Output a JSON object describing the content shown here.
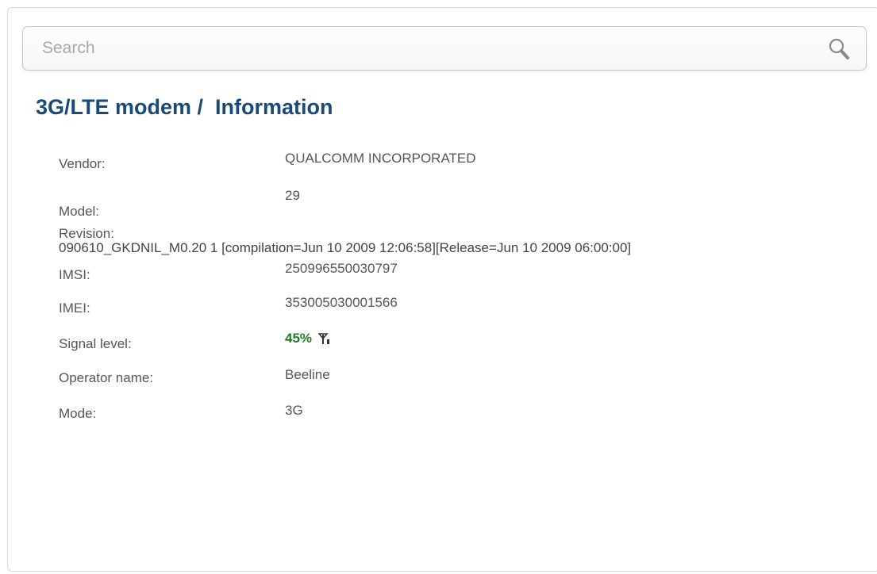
{
  "search": {
    "placeholder": "Search",
    "icon": "search-icon"
  },
  "page": {
    "title": "3G/LTE modem /  Information"
  },
  "info": {
    "vendor": {
      "label": "Vendor:",
      "value": "QUALCOMM INCORPORATED"
    },
    "model": {
      "label": "Model:",
      "value": "29"
    },
    "revision": {
      "label": "Revision:",
      "value": "090610_GKDNIL_M0.20 1 [compilation=Jun 10 2009 12:06:58][Release=Jun 10 2009 06:00:00]"
    },
    "imsi": {
      "label": "IMSI:",
      "value": "250996550030797"
    },
    "imei": {
      "label": "IMEI:",
      "value": "353005030001566"
    },
    "signal": {
      "label": "Signal level:",
      "value": "45%",
      "percent": 45,
      "icon": "antenna-signal-icon",
      "color": "#1e7d1e"
    },
    "operator": {
      "label": "Operator name:",
      "value": "Beeline"
    },
    "mode": {
      "label": "Mode:",
      "value": "3G"
    }
  },
  "colors": {
    "title": "#1a4a78",
    "text": "#555555",
    "signal": "#1e7d1e"
  }
}
